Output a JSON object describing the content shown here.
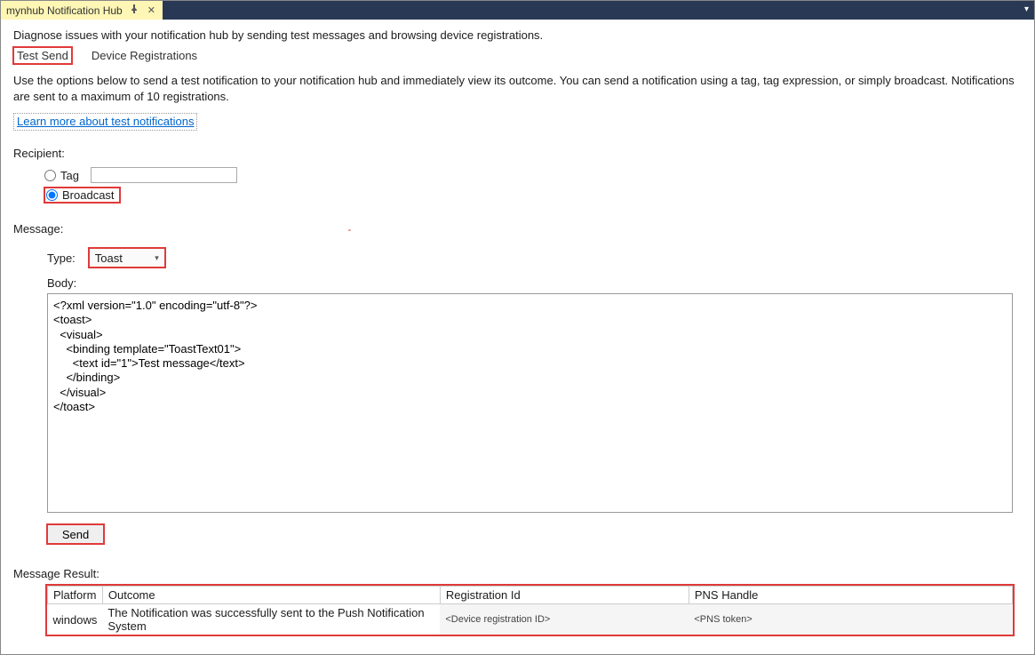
{
  "titlebar": {
    "tab_label": "mynhub Notification Hub"
  },
  "intro": "Diagnose issues with your notification hub by sending test messages and browsing device registrations.",
  "tabs": {
    "test_send": "Test Send",
    "device_registrations": "Device Registrations"
  },
  "help": {
    "paragraph": "Use the options below to send a test notification to your notification hub and immediately view its outcome. You can send a notification using a tag, tag expression, or simply broadcast. Notifications are sent to a maximum of 10 registrations.",
    "learn_more": "Learn more about test notifications"
  },
  "recipient": {
    "label": "Recipient:",
    "tag_label": "Tag",
    "tag_value": "",
    "broadcast_label": "Broadcast",
    "selected": "broadcast"
  },
  "message": {
    "label": "Message:",
    "type_label": "Type:",
    "type_value": "Toast",
    "body_label": "Body:",
    "body_value": "<?xml version=\"1.0\" encoding=\"utf-8\"?>\n<toast>\n  <visual>\n    <binding template=\"ToastText01\">\n      <text id=\"1\">Test message</text>\n    </binding>\n  </visual>\n</toast>",
    "send_label": "Send"
  },
  "result": {
    "label": "Message Result:",
    "headers": {
      "platform": "Platform",
      "outcome": "Outcome",
      "registration_id": "Registration Id",
      "pns_handle": "PNS Handle"
    },
    "row": {
      "platform": "windows",
      "outcome": "The Notification was successfully sent to the Push Notification System",
      "registration_id": "<Device registration ID>",
      "pns_handle": "<PNS token>"
    }
  }
}
